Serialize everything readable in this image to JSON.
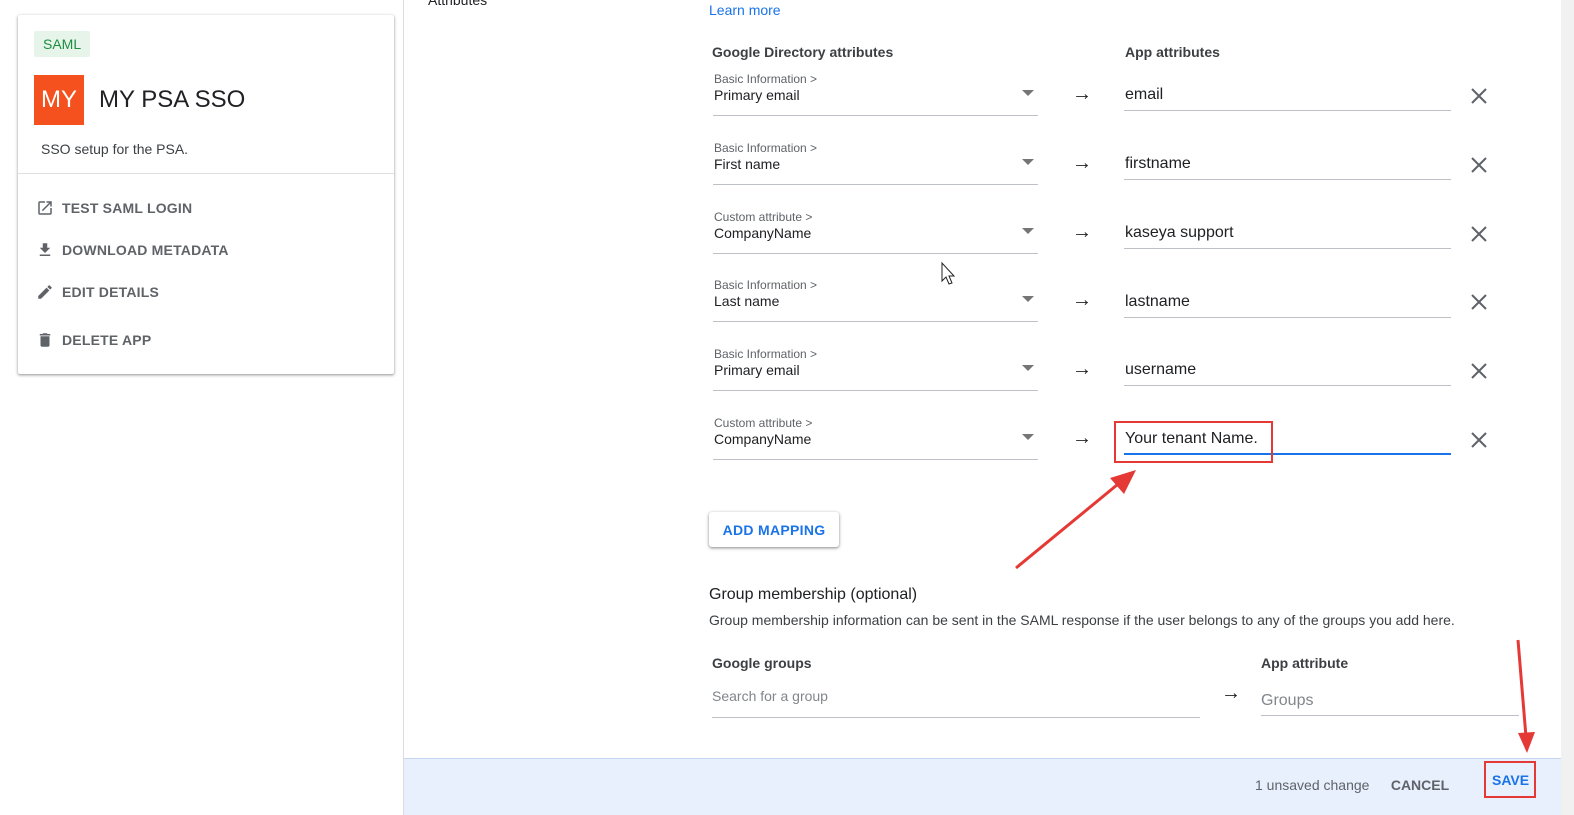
{
  "app": {
    "badge": "SAML",
    "logo_initials": "MY",
    "name": "MY PSA SSO",
    "description": "SSO setup for the PSA.",
    "actions": [
      {
        "label": "TEST SAML LOGIN",
        "icon": "open-in-new-icon"
      },
      {
        "label": "DOWNLOAD METADATA",
        "icon": "download-icon"
      },
      {
        "label": "EDIT DETAILS",
        "icon": "pencil-icon"
      },
      {
        "label": "DELETE APP",
        "icon": "trash-icon"
      }
    ]
  },
  "attributes": {
    "section_label": "Attributes",
    "learn_more": "Learn more",
    "col_directory": "Google Directory attributes",
    "col_app": "App attributes",
    "arrow": "→",
    "mappings": [
      {
        "category": "Basic Information >",
        "field": "Primary email",
        "app_attr": "email"
      },
      {
        "category": "Basic Information >",
        "field": "First name",
        "app_attr": "firstname"
      },
      {
        "category": "Custom attribute >",
        "field": "CompanyName",
        "app_attr": "kaseya support"
      },
      {
        "category": "Basic Information >",
        "field": "Last name",
        "app_attr": "lastname"
      },
      {
        "category": "Basic Information >",
        "field": "Primary email",
        "app_attr": "username"
      },
      {
        "category": "Custom attribute >",
        "field": "CompanyName",
        "app_attr": "Your tenant Name."
      }
    ],
    "add_mapping": "ADD MAPPING"
  },
  "groups": {
    "title": "Group membership (optional)",
    "description": "Group membership information can be sent in the SAML response if the user belongs to any of the groups you add here.",
    "col_groups": "Google groups",
    "search_placeholder": "Search for a group",
    "col_app": "App attribute",
    "app_placeholder": "Groups"
  },
  "footer": {
    "unsaved": "1 unsaved change",
    "cancel": "CANCEL",
    "save": "SAVE"
  },
  "colors": {
    "accent": "#1a73e8",
    "annotation": "#e53935",
    "logo": "#f4511e",
    "badge_bg": "#e6f4ea",
    "footer_bg": "#e8f0fe"
  }
}
